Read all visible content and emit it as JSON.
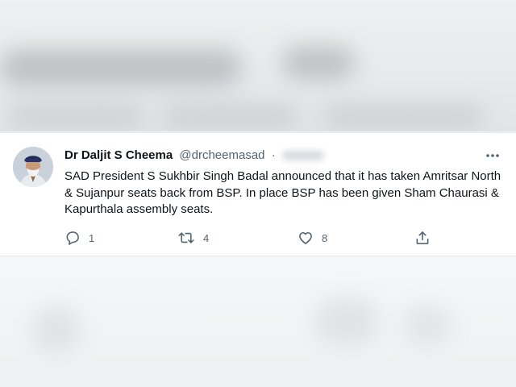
{
  "tweet": {
    "display_name": "Dr Daljit S Cheema",
    "handle": "@drcheemasad",
    "separator": "·",
    "text": "SAD President S Sukhbir Singh Badal announced that it has taken Amritsar North & Sujanpur seats back from BSP. In place BSP has been given Sham Chaurasi & Kapurthala assembly seats.",
    "stats": {
      "replies": "1",
      "retweets": "4",
      "likes": "8"
    }
  },
  "icons": {
    "more": "more-horizontal-icon",
    "reply": "reply-icon",
    "retweet": "retweet-icon",
    "like": "heart-icon",
    "share": "share-icon"
  },
  "colors": {
    "text_primary": "#0f1419",
    "text_secondary": "#536471",
    "card_background": "#ffffff"
  }
}
